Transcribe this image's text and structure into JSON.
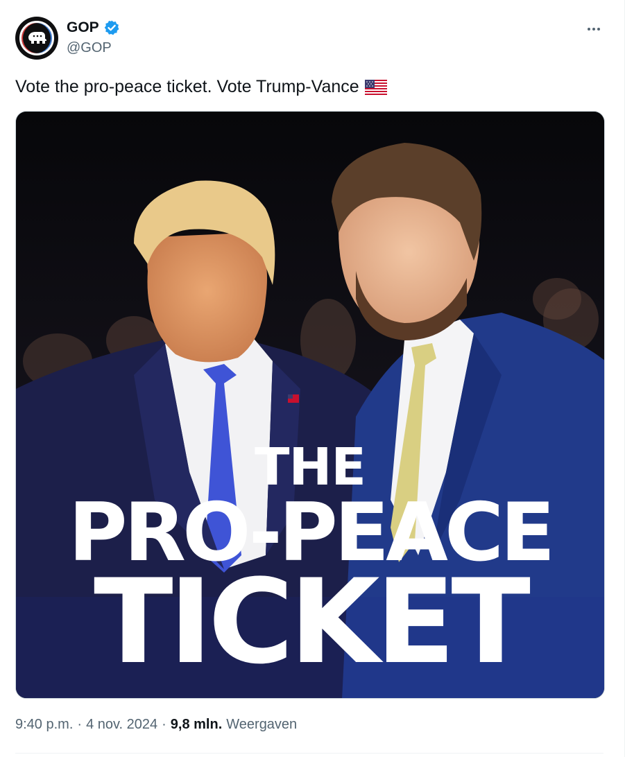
{
  "author": {
    "display_name": "GOP",
    "handle": "@GOP",
    "verified": true,
    "avatar_icon": "gop-elephant-logo"
  },
  "tweet": {
    "text": "Vote the pro-peace ticket. Vote Trump-Vance",
    "emoji": "us-flag-icon"
  },
  "media": {
    "overlay_line1": "THE",
    "overlay_line2": "PRO-PEACE",
    "overlay_line3": "TICKET"
  },
  "meta": {
    "time": "9:40 p.m.",
    "separator1": "·",
    "date": "4 nov. 2024",
    "separator2": "·",
    "views_count": "9,8 mln.",
    "views_label": "Weergaven"
  },
  "colors": {
    "verified_blue": "#1d9bf0",
    "text_primary": "#0f1419",
    "text_secondary": "#536471"
  }
}
